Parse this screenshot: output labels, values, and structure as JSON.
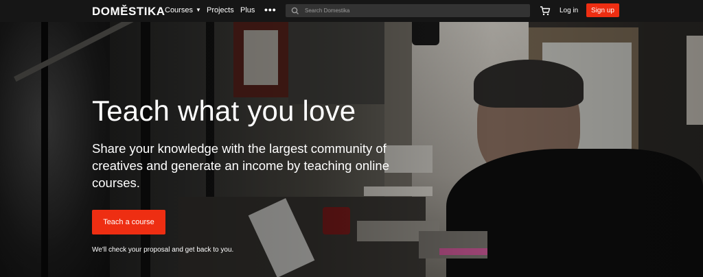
{
  "brand": {
    "logo": "DOMĚSTIKA"
  },
  "nav": {
    "courses_label": "Courses",
    "projects_label": "Projects",
    "plus_label": "Plus",
    "more_label": "•••",
    "search_placeholder": "Search Domestika",
    "login_label": "Log in",
    "signup_label": "Sign up"
  },
  "hero": {
    "headline": "Teach what you love",
    "subline": "Share your knowledge with the largest community of creatives and generate an income by teaching online courses.",
    "cta_label": "Teach a course",
    "note": "We'll check your proposal and get back to you."
  },
  "colors": {
    "accent": "#ee2e12",
    "nav_background": "#161616",
    "search_background": "#333333"
  },
  "icons": [
    "chevron-down-icon",
    "more-icon",
    "search-icon",
    "cart-icon"
  ]
}
